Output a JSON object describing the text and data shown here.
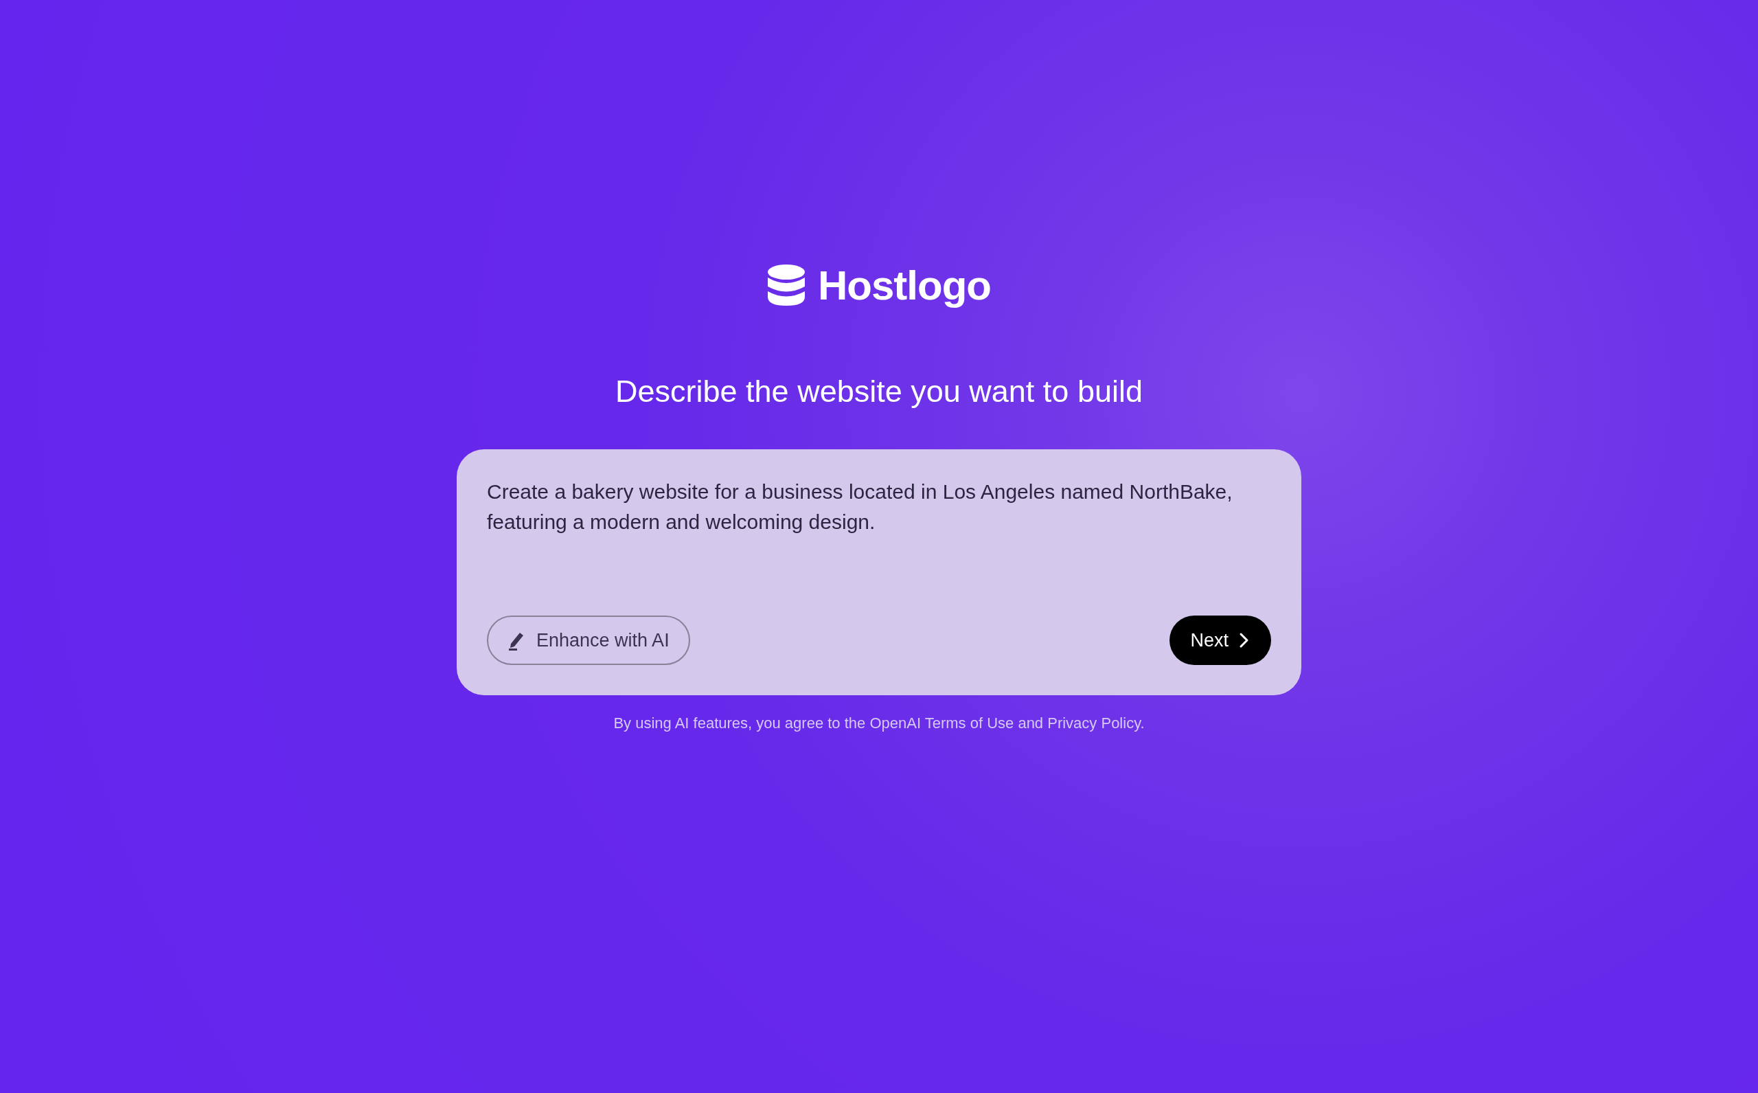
{
  "logo": {
    "text": "Hostlogo"
  },
  "heading": "Describe the website you want to build",
  "prompt": {
    "value": "Create a bakery website for a business located in Los Angeles named NorthBake, featuring a modern and welcoming design."
  },
  "buttons": [
    {
      "kind": "enhance",
      "label": "Enhance with AI"
    },
    {
      "kind": "next",
      "label": "Next"
    }
  ],
  "footer": "By using AI features, you agree to the OpenAI Terms of Use and Privacy Policy."
}
